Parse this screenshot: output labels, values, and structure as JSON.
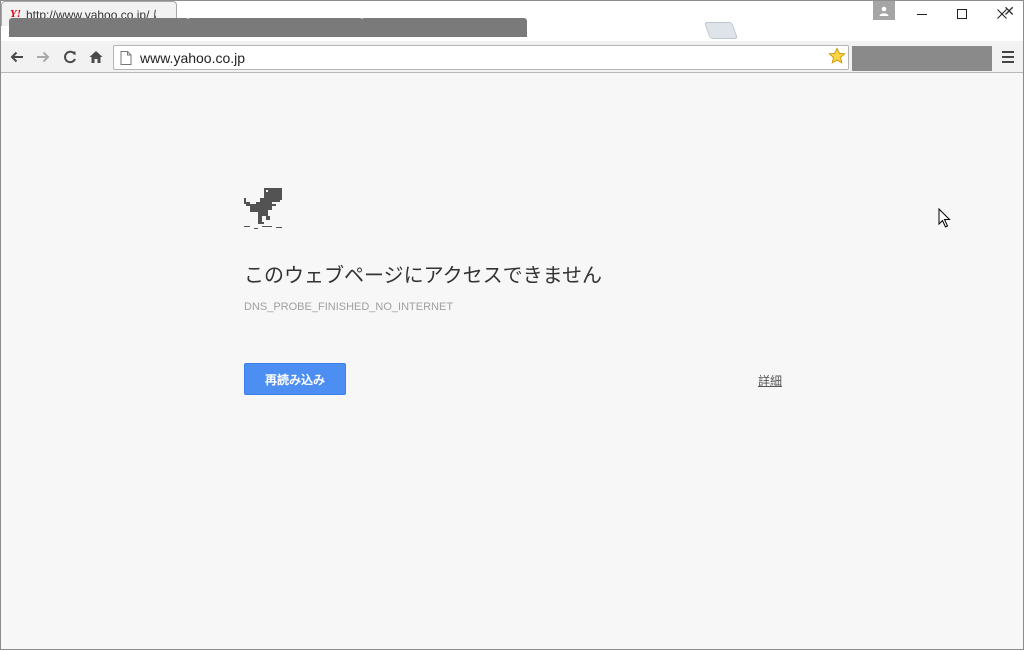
{
  "browser": {
    "active_tab": {
      "favicon_text": "Y!",
      "title": "http://www.yahoo.co.jp/ に",
      "close_glyph": "✕"
    },
    "window_controls": {
      "minimize": "—",
      "maximize": "☐",
      "close": "✕"
    },
    "toolbar": {
      "back_glyph": "←",
      "forward_glyph": "→",
      "reload_glyph": "C",
      "home_glyph": "⌂",
      "url": "www.yahoo.co.jp",
      "star_glyph": "☆"
    }
  },
  "error_page": {
    "title": "このウェブページにアクセスできません",
    "error_code": "DNS_PROBE_FINISHED_NO_INTERNET",
    "reload_button": "再読み込み",
    "details_link": "詳細"
  },
  "colors": {
    "accent_button": "#4d8ef3",
    "star": "#f7b500",
    "yahoo_red": "#e60012"
  },
  "icons": [
    "page-icon",
    "star-icon",
    "menu-icon",
    "profile-icon",
    "dino-icon",
    "cursor-icon"
  ]
}
